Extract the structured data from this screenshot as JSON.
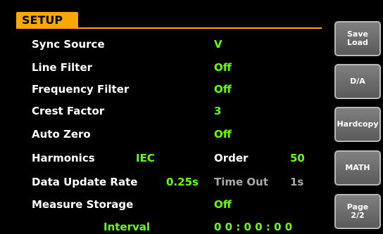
{
  "header": {
    "title": "SETUP"
  },
  "settings": {
    "sync_source": {
      "label": "Sync Source",
      "value": "V"
    },
    "line_filter": {
      "label": "Line Filter",
      "value": "Off"
    },
    "frequency_filter": {
      "label": "Frequency Filter",
      "value": "Off"
    },
    "crest_factor": {
      "label": "Crest Factor",
      "value": "3"
    },
    "auto_zero": {
      "label": "Auto Zero",
      "value": "Off"
    },
    "harmonics": {
      "label": "Harmonics",
      "value": "IEC",
      "order_label": "Order",
      "order_value": "50"
    },
    "data_update_rate": {
      "label": "Data Update Rate",
      "value": "0.25s",
      "timeout_label": "Time Out",
      "timeout_value": "1s"
    },
    "measure_storage": {
      "label": "Measure Storage",
      "value": "Off",
      "interval_label": "Interval",
      "interval_value": "0 0 : 0 0 : 0 0"
    }
  },
  "softkeys": {
    "save_load": "Save\nLoad",
    "da": "D/A",
    "hardcopy": "Hardcopy",
    "math": "MATH",
    "page": "Page\n2/2"
  },
  "colors": {
    "accent": "#f8a800",
    "value": "#66ff00",
    "label": "#ffffff",
    "inactive": "#a8a8a8",
    "background": "#000000"
  }
}
